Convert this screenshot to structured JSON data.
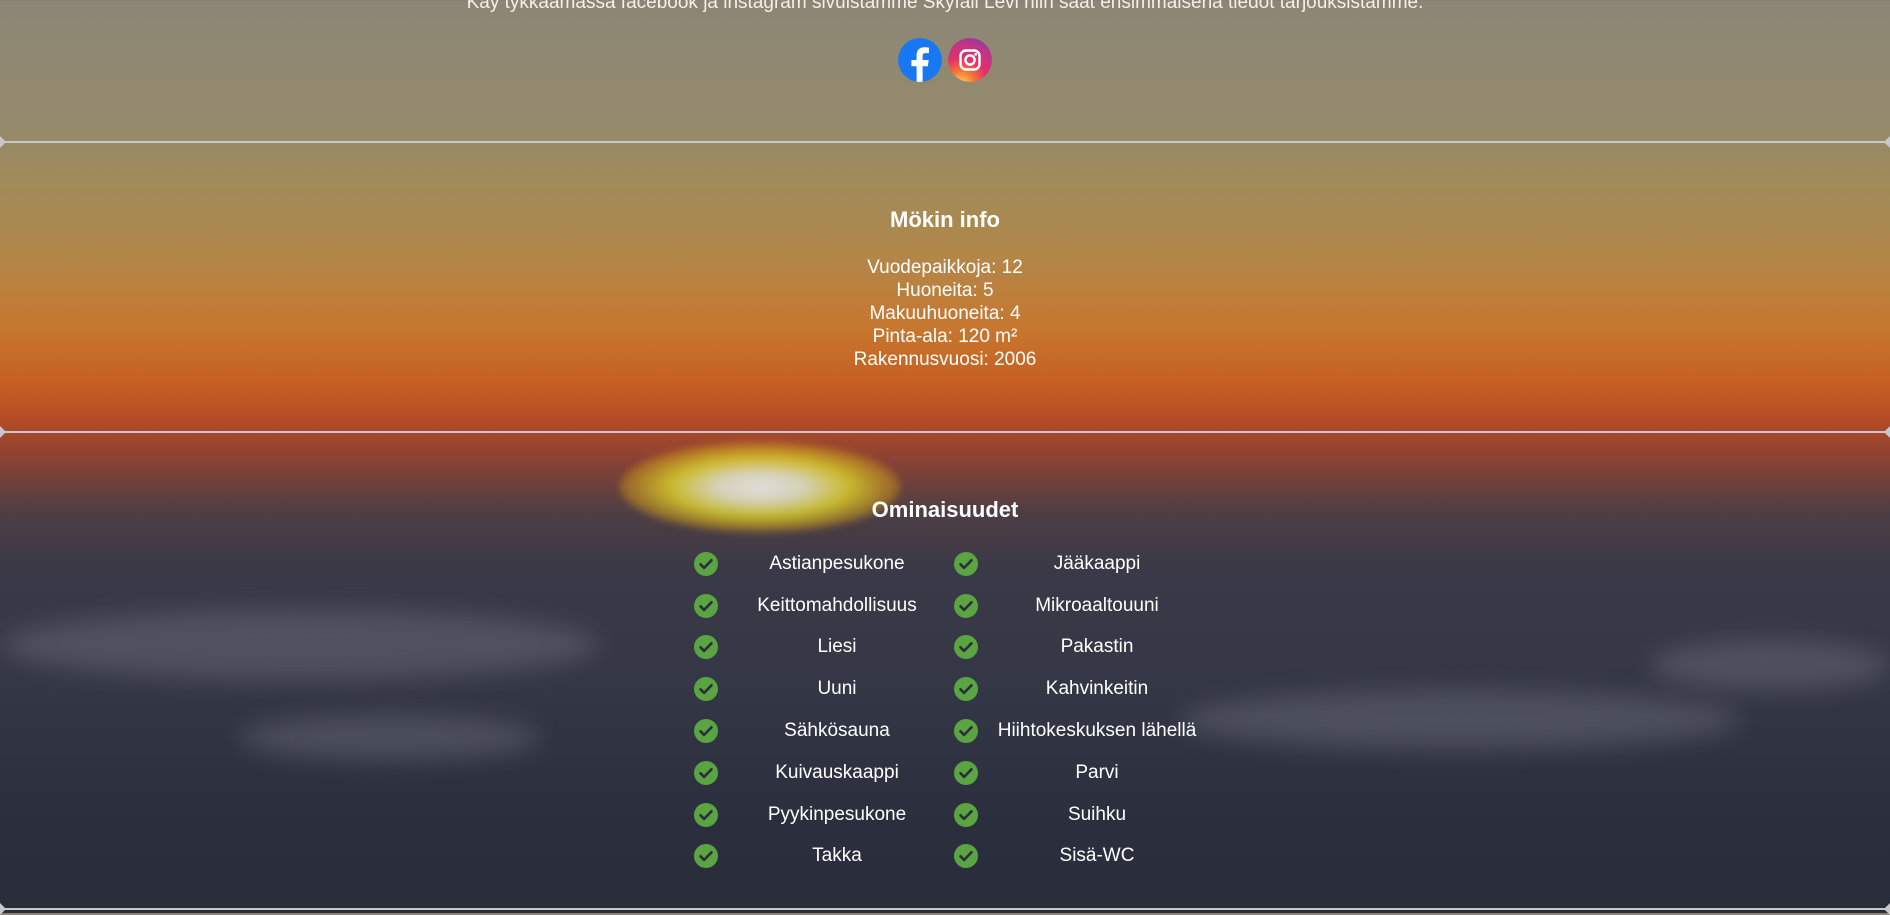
{
  "social": {
    "text": "Käy tykkäämässä facebook ja instagram sivuistamme Skyfall Levi niin saat ensimmäisenä tiedot tarjouksistamme.",
    "icons": [
      "facebook-icon",
      "instagram-icon"
    ]
  },
  "info": {
    "title": "Mökin info",
    "rows": [
      "Vuodepaikkoja: 12",
      "Huoneita: 5",
      "Makuuhuoneita: 4",
      "Pinta-ala: 120 m²",
      "Rakennusvuosi: 2006"
    ]
  },
  "features": {
    "title": "Ominaisuudet",
    "left": [
      "Astianpesukone",
      "Keittomahdollisuus",
      "Liesi",
      "Uuni",
      "Sähkösauna",
      "Kuivauskaappi",
      "Pyykinpesukone",
      "Takka"
    ],
    "right": [
      "Jääkaappi",
      "Mikroaaltouuni",
      "Pakastin",
      "Kahvinkeitin",
      "Hiihtokeskuksen lähellä",
      "Parvi",
      "Suihku",
      "Sisä-WC"
    ],
    "check_color": "#5aa541"
  },
  "colors": {
    "facebook": "#1877f2",
    "divider": "#c7c7cc"
  }
}
